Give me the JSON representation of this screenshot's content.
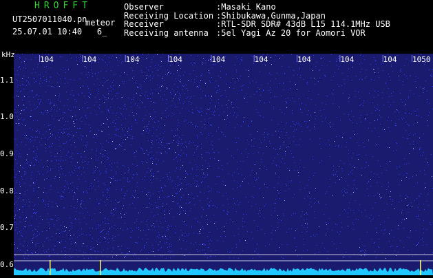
{
  "brand": {
    "text": "HROFFT",
    "color": "#31d431"
  },
  "file": {
    "name": "UT2507011040.pn",
    "tag": "meteor"
  },
  "datetime": {
    "date": "25.07.01",
    "time": "10:40",
    "value": "6_"
  },
  "info": [
    {
      "key": "Observer",
      "value": ":Masaki Kano"
    },
    {
      "key": "Receiving Location",
      "value": ":Shibukawa,Gunma,Japan"
    },
    {
      "key": "Receiver",
      "value": ":RTL-SDR SDR# 43dB L15 114.1MHz USB"
    },
    {
      "key": "Receiving antenna",
      "value": ":5el Yagi Az 20 for Aomori VOR"
    }
  ],
  "axis": {
    "unit": "kHz",
    "y_ticks": [
      {
        "label": "1.1",
        "value": 1.1
      },
      {
        "label": "1.0",
        "value": 1.0
      },
      {
        "label": "0.9",
        "value": 0.9
      },
      {
        "label": "0.8",
        "value": 0.8
      },
      {
        "label": "0.7",
        "value": 0.7
      },
      {
        "label": "0.6",
        "value": 0.6
      }
    ],
    "y_range": [
      0.57,
      1.17
    ],
    "time_labels": [
      "104",
      "104",
      "104",
      "104",
      "104",
      "104",
      "104",
      "104",
      "104",
      "1050"
    ]
  },
  "colors": {
    "background": "#1a1a6e",
    "noise": "#3040ff",
    "spectrum": "#20c8ff",
    "grid": "#ffffff",
    "marker": "#ffff66"
  }
}
